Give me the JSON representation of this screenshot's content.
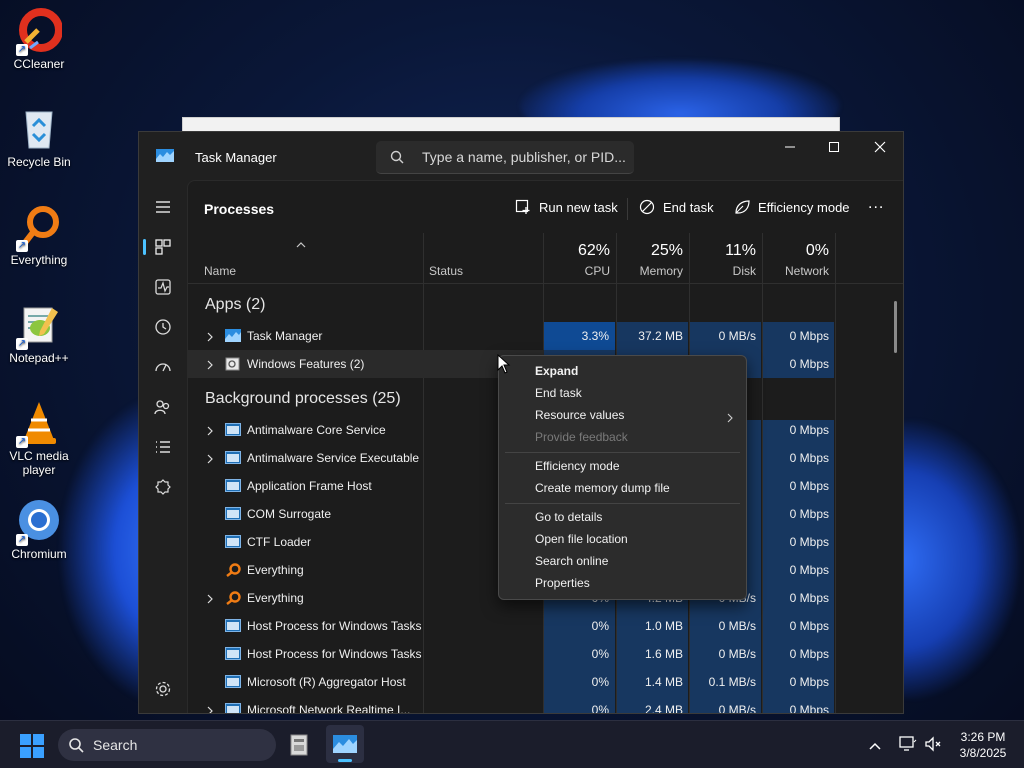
{
  "desktop": {
    "icons": [
      {
        "label": "CCleaner",
        "icon": "ccleaner-icon"
      },
      {
        "label": "Recycle Bin",
        "icon": "recycle-bin-icon"
      },
      {
        "label": "Everything",
        "icon": "everything-icon"
      },
      {
        "label": "Notepad++",
        "icon": "notepad-plus-plus-icon"
      },
      {
        "label": "VLC media player",
        "icon": "vlc-icon"
      },
      {
        "label": "Chromium",
        "icon": "chromium-icon"
      }
    ]
  },
  "window": {
    "title": "Task Manager",
    "search_placeholder": "Type a name, publisher, or PID..."
  },
  "toolbar": {
    "title": "Processes",
    "run_new_task": "Run new task",
    "end_task": "End task",
    "efficiency_mode": "Efficiency mode",
    "more": "..."
  },
  "columns": {
    "name": "Name",
    "status": "Status",
    "cpu_pct": "62%",
    "cpu": "CPU",
    "memory_pct": "25%",
    "memory": "Memory",
    "disk_pct": "11%",
    "disk": "Disk",
    "network_pct": "0%",
    "network": "Network"
  },
  "groups": {
    "apps": "Apps (2)",
    "background": "Background processes (25)"
  },
  "apps": [
    {
      "name": "Task Manager",
      "cpu": "3.3%",
      "memory": "37.2 MB",
      "disk": "0 MB/s",
      "network": "0 Mbps"
    },
    {
      "name": "Windows Features (2)",
      "cpu": "",
      "memory": "",
      "disk": "/s",
      "network": "0 Mbps"
    }
  ],
  "background": [
    {
      "name": "Antimalware Core Service",
      "cpu": "",
      "memory": "",
      "disk": "/s",
      "network": "0 Mbps"
    },
    {
      "name": "Antimalware Service Executable",
      "cpu": "",
      "memory": "",
      "disk": "/s",
      "network": "0 Mbps"
    },
    {
      "name": "Application Frame Host",
      "cpu": "",
      "memory": "",
      "disk": "/s",
      "network": "0 Mbps"
    },
    {
      "name": "COM Surrogate",
      "cpu": "",
      "memory": "",
      "disk": "/s",
      "network": "0 Mbps"
    },
    {
      "name": "CTF Loader",
      "cpu": "",
      "memory": "",
      "disk": "/s",
      "network": "0 Mbps"
    },
    {
      "name": "Everything",
      "cpu": "",
      "memory": "",
      "disk": "/s",
      "network": "0 Mbps"
    },
    {
      "name": "Everything",
      "cpu": "0%",
      "memory": "4.2 MB",
      "disk": "0 MB/s",
      "network": "0 Mbps"
    },
    {
      "name": "Host Process for Windows Tasks",
      "cpu": "0%",
      "memory": "1.0 MB",
      "disk": "0 MB/s",
      "network": "0 Mbps"
    },
    {
      "name": "Host Process for Windows Tasks",
      "cpu": "0%",
      "memory": "1.6 MB",
      "disk": "0 MB/s",
      "network": "0 Mbps"
    },
    {
      "name": "Microsoft (R) Aggregator Host",
      "cpu": "0%",
      "memory": "1.4 MB",
      "disk": "0.1 MB/s",
      "network": "0 Mbps"
    },
    {
      "name": "Microsoft Network Realtime I...",
      "cpu": "0%",
      "memory": "2.4 MB",
      "disk": "0 MB/s",
      "network": "0 Mbps"
    }
  ],
  "context_menu": {
    "expand": "Expand",
    "end_task": "End task",
    "resource_values": "Resource values",
    "provide_feedback": "Provide feedback",
    "efficiency_mode": "Efficiency mode",
    "create_dump": "Create memory dump file",
    "go_to_details": "Go to details",
    "open_file_location": "Open file location",
    "search_online": "Search online",
    "properties": "Properties"
  },
  "taskbar": {
    "search": "Search",
    "time": "3:26 PM",
    "date": "3/8/2025"
  },
  "colors": {
    "accent": "#4cc2ff",
    "heat_low": "#173760",
    "heat_high": "#0f4a94"
  }
}
